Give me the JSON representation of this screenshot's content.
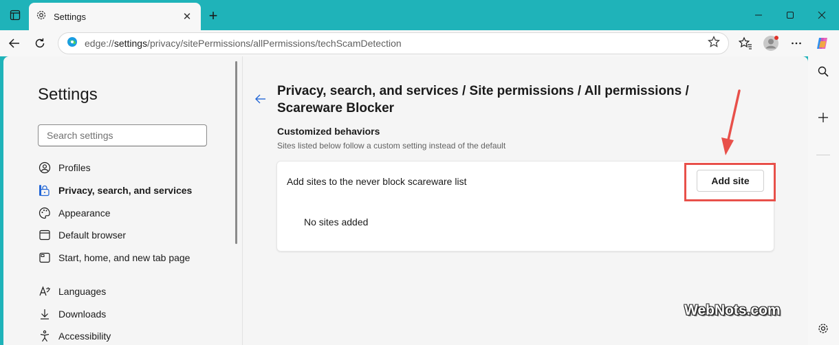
{
  "tab": {
    "title": "Settings"
  },
  "address_bar": {
    "scheme": "edge://",
    "host": "settings",
    "path": "/privacy/sitePermissions/allPermissions/techScamDetection"
  },
  "sidebar": {
    "title": "Settings",
    "search_placeholder": "Search settings",
    "items": [
      {
        "label": "Profiles",
        "icon": "profile-icon"
      },
      {
        "label": "Privacy, search, and services",
        "icon": "lock-icon",
        "active": true
      },
      {
        "label": "Appearance",
        "icon": "palette-icon"
      },
      {
        "label": "Default browser",
        "icon": "browser-icon"
      },
      {
        "label": "Start, home, and new tab page",
        "icon": "home-icon"
      },
      {
        "label": "Languages",
        "icon": "languages-icon"
      },
      {
        "label": "Downloads",
        "icon": "download-icon"
      },
      {
        "label": "Accessibility",
        "icon": "accessibility-icon"
      }
    ]
  },
  "main": {
    "heading": "Privacy, search, and services / Site permissions / All permissions / Scareware Blocker",
    "section_title": "Customized behaviors",
    "section_subtitle": "Sites listed below follow a custom setting instead of the default",
    "card_label": "Add sites to the never block scareware list",
    "add_button": "Add site",
    "empty_text": "No sites added"
  },
  "watermark": "WebNots.com",
  "colors": {
    "frame": "#1fb3b9",
    "accent": "#2266d6",
    "annotation": "#e8504a"
  }
}
